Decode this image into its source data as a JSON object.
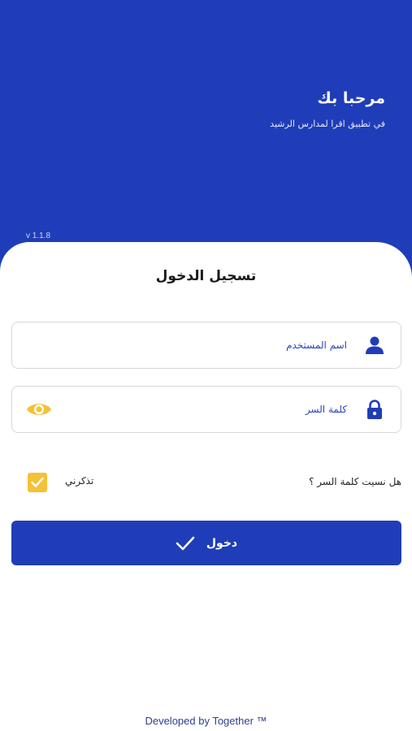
{
  "header": {
    "title": "مرحبا بك",
    "subtitle": "في تطبيق اقرا لمدارس الرشيد",
    "version": "v 1.1.8"
  },
  "login": {
    "title": "تسجيل الدخول",
    "username_placeholder": "اسم المستخدم",
    "password_placeholder": "كلمة السر",
    "remember_label": "تذكرني",
    "remember_checked": true,
    "forgot_label": "هل نسيت كلمة السر ؟",
    "submit_label": "دخول"
  },
  "footer": {
    "text": "Developed by Together ™"
  },
  "colors": {
    "primary": "#1f3db8",
    "accent": "#f5c135",
    "field_text": "#2b46b9"
  },
  "icons": {
    "username": "user-icon",
    "password": "lock-icon",
    "show_password": "eye-icon",
    "submit": "checkmark-icon",
    "remember": "checkbox-check-icon"
  }
}
